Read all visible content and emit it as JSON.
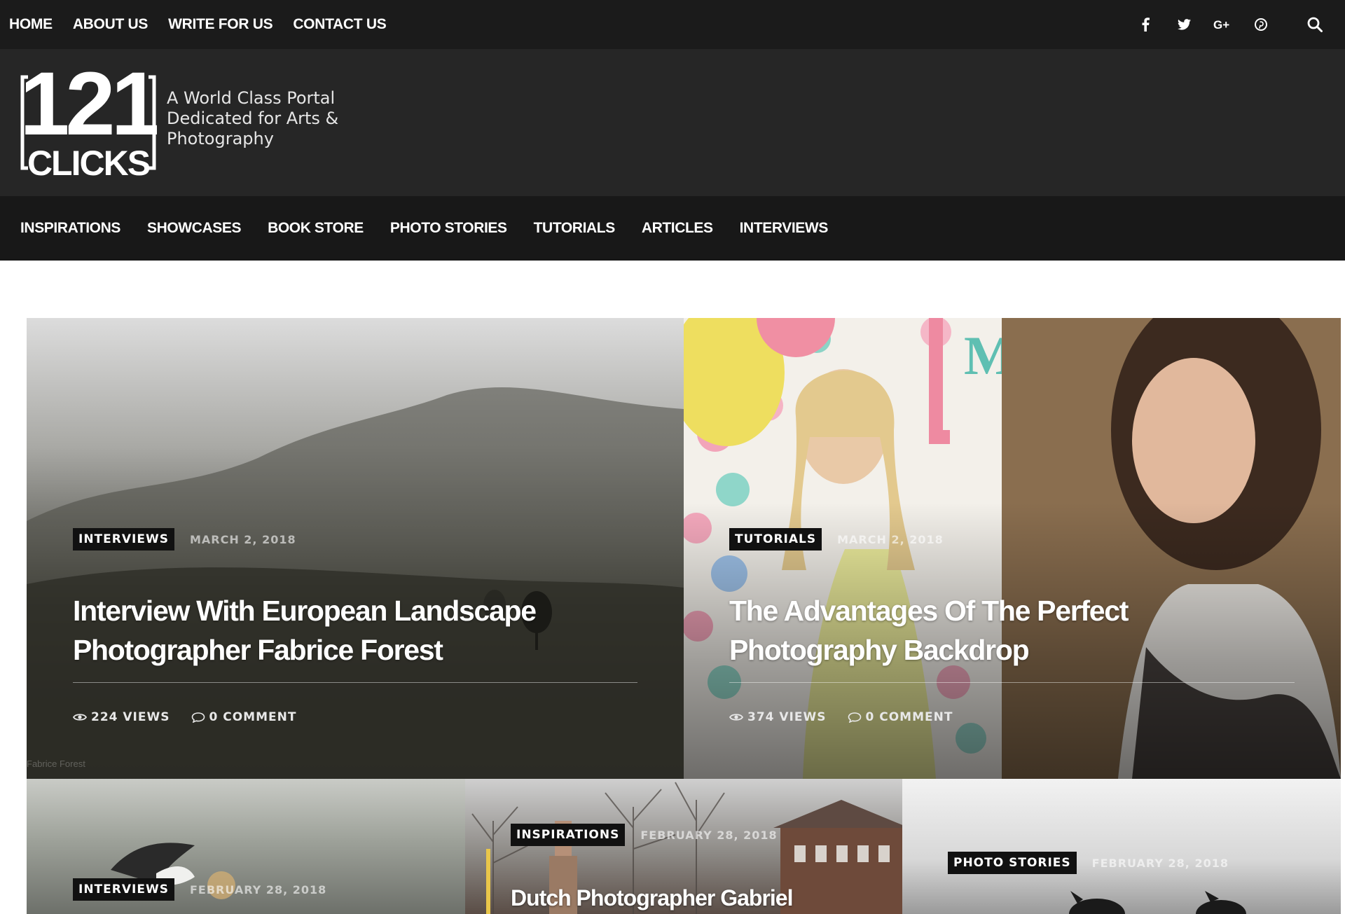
{
  "topbar": {
    "links": [
      "HOME",
      "ABOUT US",
      "WRITE FOR US",
      "CONTACT US"
    ],
    "social_icons": [
      "facebook-icon",
      "twitter-icon",
      "google-plus-icon",
      "pinterest-icon"
    ],
    "search_icon": "search-icon"
  },
  "header": {
    "logo": {
      "line1": "121",
      "line2": "CLICKS"
    },
    "tagline": [
      "A World Class Portal",
      "Dedicated for Arts &",
      "Photography"
    ]
  },
  "mainnav": {
    "items": [
      "INSPIRATIONS",
      "SHOWCASES",
      "BOOK STORE",
      "PHOTO STORIES",
      "TUTORIALS",
      "ARTICLES",
      "INTERVIEWS"
    ]
  },
  "posts": [
    {
      "category": "INTERVIEWS",
      "date": "MARCH 2, 2018",
      "title_lines": [
        "Interview With European Landscape",
        "Photographer Fabrice Forest"
      ],
      "views": "224 VIEWS",
      "comments": "0 COMMENT",
      "credit": "Fabrice Forest"
    },
    {
      "category": "TUTORIALS",
      "date": "MARCH 2, 2018",
      "title_lines": [
        "The Advantages Of The Perfect",
        "Photography Backdrop"
      ],
      "views": "374 VIEWS",
      "comments": "0 COMMENT"
    },
    {
      "category": "INTERVIEWS",
      "date": "FEBRUARY 28, 2018"
    },
    {
      "category": "INSPIRATIONS",
      "date": "FEBRUARY 28, 2018",
      "title": "Dutch Photographer Gabriel"
    },
    {
      "category": "PHOTO STORIES",
      "date": "FEBRUARY 28, 2018"
    }
  ]
}
